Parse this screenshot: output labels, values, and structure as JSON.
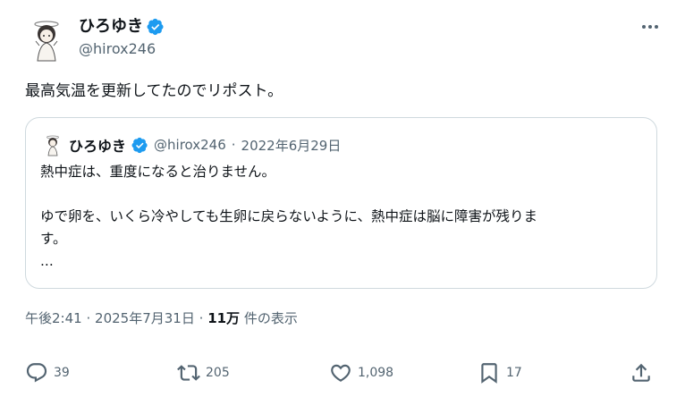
{
  "tweet": {
    "author": {
      "display_name": "ひろゆき",
      "handle": "@hirox246",
      "verified": true
    },
    "text": "最高気温を更新してたのでリポスト。",
    "quoted": {
      "display_name": "ひろゆき",
      "handle": "@hirox246",
      "separator": "·",
      "date": "2022年6月29日",
      "line1": "熱中症は、重度になると治りません。",
      "line2": "ゆで卵を、いくら冷やしても生卵に戻らないように、熱中症は脳に障害が残りま",
      "line3": "す。",
      "ellipsis": "..."
    },
    "meta": {
      "time": "午後2:41",
      "separator": "·",
      "date": "2025年7月31日",
      "separator2": "·",
      "views": "11万",
      "views_label": "件の表示"
    },
    "actions": {
      "replies": "39",
      "reposts": "205",
      "likes": "1,098",
      "bookmarks": "17"
    }
  },
  "colors": {
    "text": "#0f1419",
    "muted": "#536471",
    "border": "#cfd9de",
    "verified_blue": "#1d9bf0"
  },
  "icons": [
    "more-icon",
    "verified-badge-icon",
    "reply-icon",
    "repost-icon",
    "like-icon",
    "bookmark-icon",
    "share-icon"
  ]
}
